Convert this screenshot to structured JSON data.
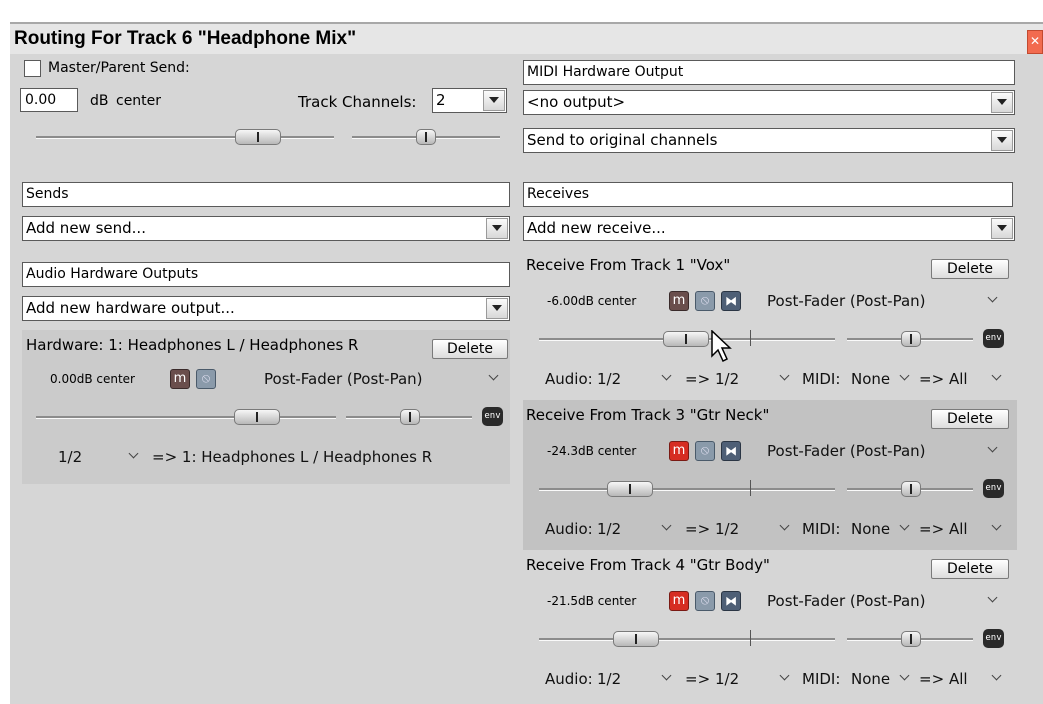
{
  "window": {
    "title": "Routing For Track 6 \"Headphone Mix\"",
    "close_icon": "close-icon"
  },
  "master": {
    "checkbox_label": "Master/Parent Send:",
    "volume_value": "0.00",
    "db_label": "dB",
    "pan_label": "center",
    "channels_label": "Track Channels:",
    "channels_value": "2"
  },
  "midi_hw": {
    "header": "MIDI Hardware Output",
    "device": "<no output>",
    "channel_mode": "Send to original channels"
  },
  "sends": {
    "header": "Sends",
    "add_placeholder": "Add new send..."
  },
  "audio_hw": {
    "header": "Audio Hardware Outputs",
    "add_placeholder": "Add new hardware output...",
    "output": {
      "title": "Hardware: 1: Headphones L / Headphones R",
      "delete_label": "Delete",
      "level_text": "0.00dB center",
      "mute_label": "m",
      "mode": "Post-Fader (Post-Pan)",
      "env_label": "env",
      "channel_value": "1/2",
      "dest_text": "=> 1: Headphones L / Headphones R",
      "volume_fraction": 0.72,
      "pan_fraction": 0.5
    }
  },
  "receives": {
    "header": "Receives",
    "add_placeholder": "Add new receive...",
    "items": [
      {
        "title": "Receive From Track 1 \"Vox\"",
        "delete_label": "Delete",
        "level_text": "-6.00dB center",
        "mute_label": "m",
        "mute_active": false,
        "mode": "Post-Fader (Post-Pan)",
        "env_label": "env",
        "audio_label": "Audio:",
        "audio_src": "1/2",
        "arrow_text": "=>",
        "audio_dst": "1/2",
        "midi_label": "MIDI:",
        "midi_src": "None",
        "midi_arrow": "=>",
        "midi_dst": "All",
        "volume_fraction": 0.5,
        "pan_fraction": 0.5,
        "highlight": false
      },
      {
        "title": "Receive From Track 3 \"Gtr Neck\"",
        "delete_label": "Delete",
        "level_text": "-24.3dB center",
        "mute_label": "m",
        "mute_active": true,
        "mode": "Post-Fader (Post-Pan)",
        "env_label": "env",
        "audio_label": "Audio:",
        "audio_src": "1/2",
        "arrow_text": "=>",
        "audio_dst": "1/2",
        "midi_label": "MIDI:",
        "midi_src": "None",
        "midi_arrow": "=>",
        "midi_dst": "All",
        "volume_fraction": 0.22,
        "pan_fraction": 0.5,
        "highlight": true
      },
      {
        "title": "Receive From Track 4 \"Gtr Body\"",
        "delete_label": "Delete",
        "level_text": "-21.5dB center",
        "mute_label": "m",
        "mute_active": true,
        "mode": "Post-Fader (Post-Pan)",
        "env_label": "env",
        "audio_label": "Audio:",
        "audio_src": "1/2",
        "arrow_text": "=>",
        "audio_dst": "1/2",
        "midi_label": "MIDI:",
        "midi_src": "None",
        "midi_arrow": "=>",
        "midi_dst": "All",
        "volume_fraction": 0.26,
        "pan_fraction": 0.5,
        "highlight": false
      }
    ]
  }
}
